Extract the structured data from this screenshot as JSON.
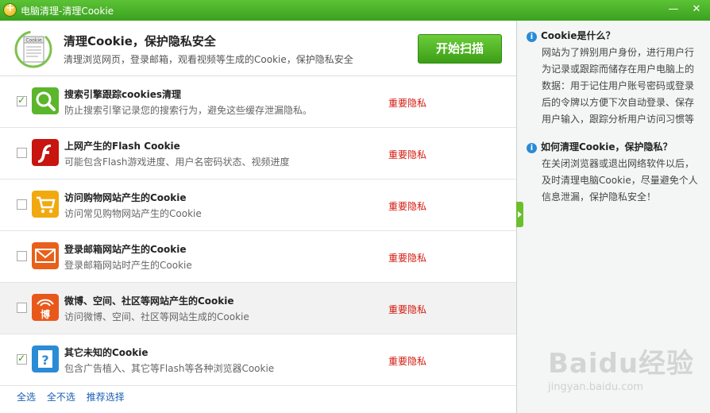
{
  "window": {
    "title": "电脑清理-清理Cookie"
  },
  "header": {
    "icon_label": "Cookie",
    "title": "清理Cookie，保护隐私安全",
    "subtitle": "清理浏览网页，登录邮箱，观看视频等生成的Cookie，保护隐私安全",
    "scan_button": "开始扫描"
  },
  "items": [
    {
      "title": "搜索引擎跟踪cookies清理",
      "desc": "防止搜索引擎记录您的搜索行为，避免这些缓存泄漏隐私。",
      "badge": "重要隐私",
      "checked": true,
      "icon": "search-magnifier-icon"
    },
    {
      "title": "上网产生的Flash Cookie",
      "desc": "可能包含Flash游戏进度、用户名密码状态、视频进度",
      "badge": "重要隐私",
      "checked": false,
      "icon": "flash-icon"
    },
    {
      "title": "访问购物网站产生的Cookie",
      "desc": "访问常见购物网站产生的Cookie",
      "badge": "重要隐私",
      "checked": false,
      "icon": "shopping-cart-icon"
    },
    {
      "title": "登录邮箱网站产生的Cookie",
      "desc": "登录邮箱网站时产生的Cookie",
      "badge": "重要隐私",
      "checked": false,
      "icon": "mail-envelope-icon"
    },
    {
      "title": "微博、空间、社区等网站产生的Cookie",
      "desc": "访问微博、空间、社区等网站生成的Cookie",
      "badge": "重要隐私",
      "checked": false,
      "icon": "weibo-icon",
      "icon_text": "博"
    },
    {
      "title": "其它未知的Cookie",
      "desc": "包含广告植入、其它等Flash等各种浏览器Cookie",
      "badge": "重要隐私",
      "checked": true,
      "icon": "question-icon"
    }
  ],
  "footer": {
    "select_all": "全选",
    "select_none": "全不选",
    "recommended": "推荐选择"
  },
  "sidebar": {
    "q1": "Cookie是什么？",
    "a1": "网站为了辨别用户身份，进行用户行为记录或跟踪而储存在用户电脑上的数据：用于记住用户账号密码或登录后的令牌以方便下次自动登录、保存用户输入，跟踪分析用户访问习惯等",
    "q2": "如何清理Cookie，保护隐私？",
    "a2": "在关闭浏览器或退出网络软件以后，及时清理电脑Cookie，尽量避免个人信息泄漏，保护隐私安全！"
  },
  "watermark": {
    "brand": "Baidu经验",
    "url": "jingyan.baidu.com"
  },
  "colors": {
    "titlebar": "#3aa11f",
    "accent": "#5cc235",
    "badge": "#d21a0e",
    "link": "#1a5fb4"
  }
}
